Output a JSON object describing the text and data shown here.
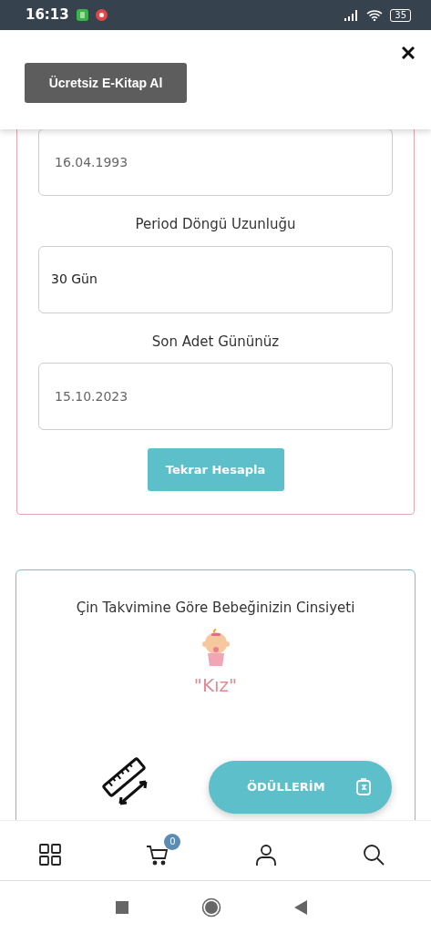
{
  "status_bar": {
    "time": "16:13",
    "battery": "35"
  },
  "banner": {
    "button": "Ücretsiz E-Kitap Al"
  },
  "form": {
    "fields": [
      {
        "value": "16.04.1993",
        "kind": "date"
      },
      {
        "label": "Period Döngü Uzunluğu",
        "value": "30 Gün",
        "kind": "select"
      },
      {
        "label": "Son Adet Gününüz",
        "value": "15.10.2023",
        "kind": "date"
      }
    ],
    "button": "Tekrar Hesapla"
  },
  "gender_card": {
    "title": "Çin Takvimine Göre Bebeğinizin Cinsiyeti",
    "result": "\"Kız\""
  },
  "fab": {
    "label": "ÖDÜLLERİM"
  },
  "bottom_nav": [
    {
      "kind": "grid"
    },
    {
      "kind": "cart",
      "badge": "0"
    },
    {
      "kind": "user"
    },
    {
      "kind": "search"
    }
  ]
}
